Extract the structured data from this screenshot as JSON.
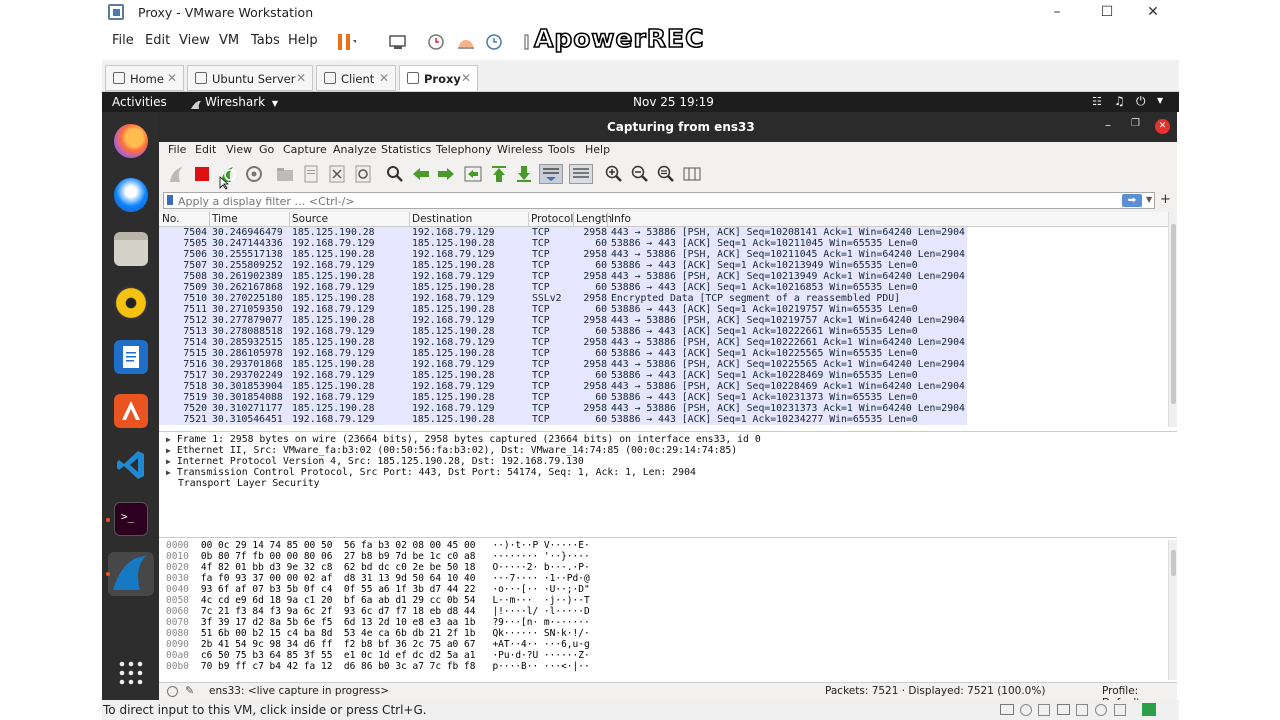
{
  "vmware": {
    "window_title": "Proxy - VMware Workstation",
    "menu": [
      "File",
      "Edit",
      "View",
      "VM",
      "Tabs",
      "Help"
    ],
    "watermark": "ApowerREC",
    "tabs": [
      {
        "label": "Home",
        "active": false
      },
      {
        "label": "Ubuntu Server",
        "active": false
      },
      {
        "label": "Client",
        "active": false
      },
      {
        "label": "Proxy",
        "active": true
      }
    ],
    "status_text": "To direct input to this VM, click inside or press Ctrl+G."
  },
  "ubuntu": {
    "activities": "Activities",
    "app_menu": "Wireshark",
    "datetime": "Nov 25  19:19",
    "dock_items": [
      "firefox-icon",
      "thunderbird-icon",
      "files-icon",
      "rhythmbox-icon",
      "writer-icon",
      "software-center-icon",
      "vscode-icon",
      "terminal-icon",
      "wireshark-icon",
      "show-apps-icon"
    ]
  },
  "wireshark": {
    "title": "Capturing from ens33",
    "menu": [
      "File",
      "Edit",
      "View",
      "Go",
      "Capture",
      "Analyze",
      "Statistics",
      "Telephony",
      "Wireless",
      "Tools",
      "Help"
    ],
    "filter_placeholder": "Apply a display filter … <Ctrl-/>",
    "columns": [
      "No.",
      "Time",
      "Source",
      "Destination",
      "Protocol",
      "Length",
      "Info"
    ],
    "packets": [
      [
        "7504",
        "30.246946479",
        "185.125.190.28",
        "192.168.79.129",
        "TCP",
        "2958",
        "443 → 53886 [PSH, ACK] Seq=10208141 Ack=1 Win=64240 Len=2904 …"
      ],
      [
        "7505",
        "30.247144336",
        "192.168.79.129",
        "185.125.190.28",
        "TCP",
        "60",
        "53886 → 443 [ACK] Seq=1 Ack=10211045 Win=65535 Len=0"
      ],
      [
        "7506",
        "30.255517138",
        "185.125.190.28",
        "192.168.79.129",
        "TCP",
        "2958",
        "443 → 53886 [PSH, ACK] Seq=10211045 Ack=1 Win=64240 Len=2904 …"
      ],
      [
        "7507",
        "30.255809252",
        "192.168.79.129",
        "185.125.190.28",
        "TCP",
        "60",
        "53886 → 443 [ACK] Seq=1 Ack=10213949 Win=65535 Len=0"
      ],
      [
        "7508",
        "30.261902389",
        "185.125.190.28",
        "192.168.79.129",
        "TCP",
        "2958",
        "443 → 53886 [PSH, ACK] Seq=10213949 Ack=1 Win=64240 Len=2904 …"
      ],
      [
        "7509",
        "30.262167868",
        "192.168.79.129",
        "185.125.190.28",
        "TCP",
        "60",
        "53886 → 443 [ACK] Seq=1 Ack=10216853 Win=65535 Len=0"
      ],
      [
        "7510",
        "30.270225180",
        "185.125.190.28",
        "192.168.79.129",
        "SSLv2",
        "2958",
        "Encrypted Data [TCP segment of a reassembled PDU]"
      ],
      [
        "7511",
        "30.271059350",
        "192.168.79.129",
        "185.125.190.28",
        "TCP",
        "60",
        "53886 → 443 [ACK] Seq=1 Ack=10219757 Win=65535 Len=0"
      ],
      [
        "7512",
        "30.277879077",
        "185.125.190.28",
        "192.168.79.129",
        "TCP",
        "2958",
        "443 → 53886 [PSH, ACK] Seq=10219757 Ack=1 Win=64240 Len=2904 …"
      ],
      [
        "7513",
        "30.278088518",
        "192.168.79.129",
        "185.125.190.28",
        "TCP",
        "60",
        "53886 → 443 [ACK] Seq=1 Ack=10222661 Win=65535 Len=0"
      ],
      [
        "7514",
        "30.285932515",
        "185.125.190.28",
        "192.168.79.129",
        "TCP",
        "2958",
        "443 → 53886 [PSH, ACK] Seq=10222661 Ack=1 Win=64240 Len=2904 …"
      ],
      [
        "7515",
        "30.286105978",
        "192.168.79.129",
        "185.125.190.28",
        "TCP",
        "60",
        "53886 → 443 [ACK] Seq=1 Ack=10225565 Win=65535 Len=0"
      ],
      [
        "7516",
        "30.293701868",
        "185.125.190.28",
        "192.168.79.129",
        "TCP",
        "2958",
        "443 → 53886 [PSH, ACK] Seq=10225565 Ack=1 Win=64240 Len=2904 …"
      ],
      [
        "7517",
        "30.293702249",
        "192.168.79.129",
        "185.125.190.28",
        "TCP",
        "60",
        "53886 → 443 [ACK] Seq=1 Ack=10228469 Win=65535 Len=0"
      ],
      [
        "7518",
        "30.301853904",
        "185.125.190.28",
        "192.168.79.129",
        "TCP",
        "2958",
        "443 → 53886 [PSH, ACK] Seq=10228469 Ack=1 Win=64240 Len=2904 …"
      ],
      [
        "7519",
        "30.301854088",
        "192.168.79.129",
        "185.125.190.28",
        "TCP",
        "60",
        "53886 → 443 [ACK] Seq=1 Ack=10231373 Win=65535 Len=0"
      ],
      [
        "7520",
        "30.310271177",
        "185.125.190.28",
        "192.168.79.129",
        "TCP",
        "2958",
        "443 → 53886 [PSH, ACK] Seq=10231373 Ack=1 Win=64240 Len=2904 …"
      ],
      [
        "7521",
        "30.310546451",
        "192.168.79.129",
        "185.125.190.28",
        "TCP",
        "60",
        "53886 → 443 [ACK] Seq=1 Ack=10234277 Win=65535 Len=0"
      ]
    ],
    "details": [
      {
        "expandable": true,
        "text": "Frame 1: 2958 bytes on wire (23664 bits), 2958 bytes captured (23664 bits) on interface ens33, id 0"
      },
      {
        "expandable": true,
        "text": "Ethernet II, Src: VMware_fa:b3:02 (00:50:56:fa:b3:02), Dst: VMware_14:74:85 (00:0c:29:14:74:85)"
      },
      {
        "expandable": true,
        "text": "Internet Protocol Version 4, Src: 185.125.190.28, Dst: 192.168.79.130"
      },
      {
        "expandable": true,
        "text": "Transmission Control Protocol, Src Port: 443, Dst Port: 54174, Seq: 1, Ack: 1, Len: 2904"
      },
      {
        "expandable": false,
        "text": "Transport Layer Security"
      }
    ],
    "bytes": [
      [
        "0000",
        "00 0c 29 14 74 85 00 50  56 fa b3 02 08 00 45 00",
        "··)·t··P V·····E·"
      ],
      [
        "0010",
        "0b 80 7f fb 00 00 80 06  27 b8 b9 7d be 1c c0 a8",
        "········ '··}····"
      ],
      [
        "0020",
        "4f 82 01 bb d3 9e 32 c8  62 bd dc c0 2e be 50 18",
        "O·····2· b···.·P·"
      ],
      [
        "0030",
        "fa f0 93 37 00 00 02 af  d8 31 13 9d 50 64 10 40",
        "···7···· ·1··Pd·@"
      ],
      [
        "0040",
        "93 6f af 07 b3 5b 0f c4  0f 55 a6 1f 3b d7 44 22",
        "·o···[·· ·U··;·D\""
      ],
      [
        "0050",
        "4c cd e9 6d 18 9a c1 20  bf 6a ab d1 29 cc 0b 54",
        "L··m···  ·j··)··T"
      ],
      [
        "0060",
        "7c 21 f3 84 f3 9a 6c 2f  93 6c d7 f7 18 eb d8 44",
        "|!····l/ ·l·····D"
      ],
      [
        "0070",
        "3f 39 17 d2 8a 5b 6e f5  6d 13 2d 10 e8 e3 aa 1b",
        "?9···[n· m·-·····"
      ],
      [
        "0080",
        "51 6b 00 b2 15 c4 ba 8d  53 4e ca 6b db 21 2f 1b",
        "Qk······ SN·k·!/·"
      ],
      [
        "0090",
        "2b 41 54 9c 98 34 d6 ff  f2 b8 bf 36 2c 75 a0 67",
        "+AT··4·· ···6,u·g"
      ],
      [
        "00a0",
        "c6 50 75 b3 64 85 3f 55  e1 0c 1d ef dc d2 5a a1",
        "·Pu·d·?U ······Z·"
      ],
      [
        "00b0",
        "70 b9 ff c7 b4 42 fa 12  d6 86 b0 3c a7 7c fb f8",
        "p····B·· ···<·|··"
      ]
    ],
    "status": {
      "interface": "ens33: <live capture in progress>",
      "packets": "Packets: 7521 · Displayed: 7521 (100.0%)",
      "profile": "Profile: Default"
    }
  },
  "colors": {
    "row_bg": "#e7e6ff",
    "accent_red": "#e5322d",
    "ubuntu_dark": "#2d2d2d"
  }
}
